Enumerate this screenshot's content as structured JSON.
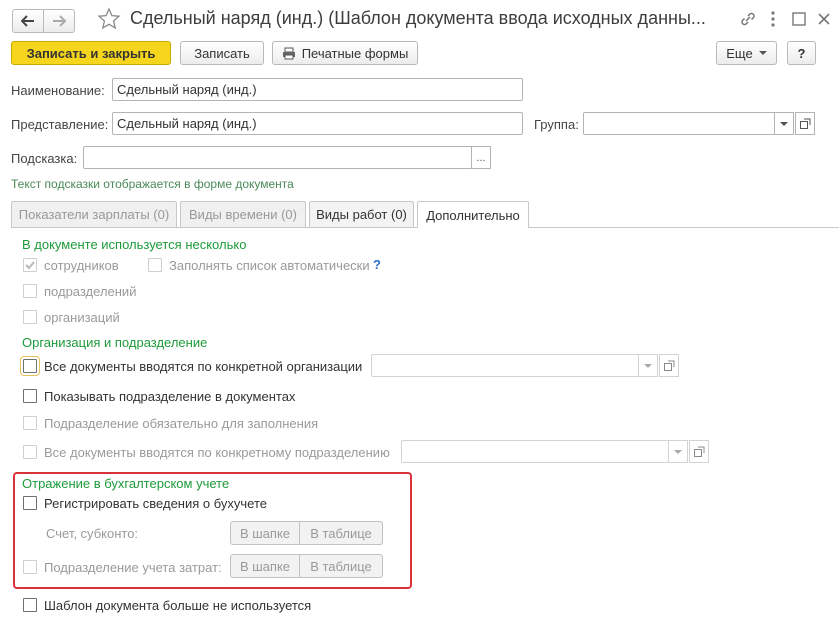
{
  "window": {
    "title": "Сдельный наряд (инд.) (Шаблон документа ввода исходных данны...",
    "link_icon": "link-icon",
    "more_icon": "more-vertical-icon",
    "maximize_icon": "maximize-icon",
    "close_icon": "close-icon"
  },
  "toolbar": {
    "save_close_label": "Записать и закрыть",
    "save_label": "Записать",
    "print_label": "Печатные формы",
    "more_label": "Еще",
    "help_label": "?"
  },
  "form": {
    "name_label": "Наименование:",
    "name_value": "Сдельный наряд (инд.)",
    "repr_label": "Представление:",
    "repr_value": "Сдельный наряд (инд.)",
    "group_label": "Группа:",
    "group_value": "",
    "hint_label": "Подсказка:",
    "hint_value": "",
    "hint_note": "Текст подсказки отображается в форме документа"
  },
  "tabs": [
    {
      "label": "Показатели зарплаты (0)"
    },
    {
      "label": "Виды времени (0)"
    },
    {
      "label": "Виды работ (0)"
    },
    {
      "label": "Дополнительно"
    }
  ],
  "section_multi": {
    "title": "В документе используется несколько",
    "employees": "сотрудников",
    "autofill": "Заполнять список автоматически",
    "help": "?",
    "departments": "подразделений",
    "organizations": "организаций"
  },
  "section_org": {
    "title": "Организация и подразделение",
    "specific_org": "Все документы вводятся по конкретной организации",
    "show_dept": "Показывать подразделение в документах",
    "dept_required": "Подразделение обязательно для заполнения",
    "specific_dept": "Все документы вводятся по конкретному подразделению"
  },
  "section_acc": {
    "title": "Отражение в бухгалтерском учете",
    "register": "Регистрировать сведения о бухучете",
    "account_label": "Счет, субконто:",
    "cost_dept": "Подразделение учета затрат:",
    "in_header": "В шапке",
    "in_table": "В таблице"
  },
  "footer": {
    "not_used": "Шаблон документа больше не используется"
  },
  "colors": {
    "primary_button": "#f5d81c",
    "section_title": "#1e9b3a",
    "highlight_frame": "#d9333a"
  }
}
